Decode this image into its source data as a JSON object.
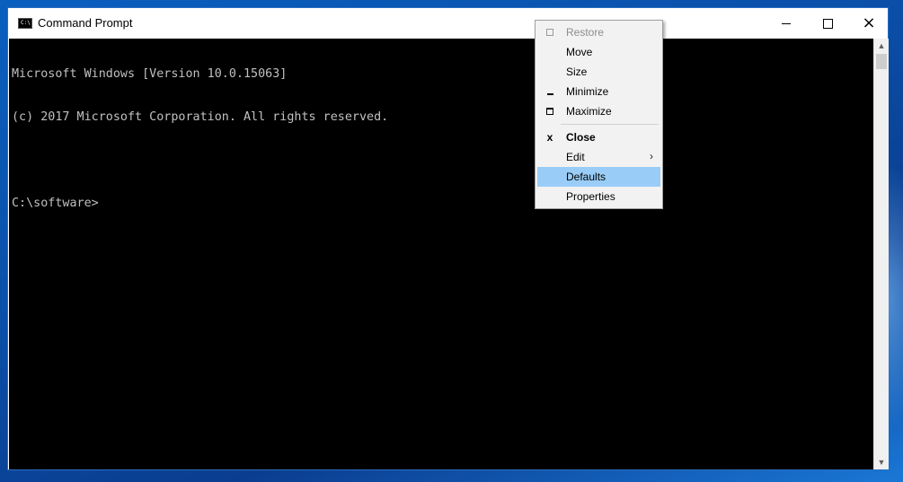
{
  "window": {
    "title": "Command Prompt",
    "app_icon_glyph": "C:\\",
    "controls": {
      "minimize": "minimize-icon",
      "maximize": "maximize-icon",
      "close": "×"
    }
  },
  "console": {
    "lines": [
      "Microsoft Windows [Version 10.0.15063]",
      "(c) 2017 Microsoft Corporation. All rights reserved.",
      "",
      "C:\\software>"
    ]
  },
  "system_menu": {
    "items": [
      {
        "label": "Restore",
        "icon": "restore-icon",
        "disabled": true
      },
      {
        "label": "Move"
      },
      {
        "label": "Size"
      },
      {
        "label": "Minimize",
        "icon": "minimize-icon"
      },
      {
        "label": "Maximize",
        "icon": "maximize-icon"
      },
      {
        "label": "Close",
        "icon": "close-icon",
        "icon_glyph": "x",
        "bold": true
      },
      {
        "label": "Edit",
        "submenu_arrow": "›"
      },
      {
        "label": "Defaults",
        "highlighted": true
      },
      {
        "label": "Properties"
      }
    ]
  },
  "colors": {
    "console_bg": "#000000",
    "console_text": "#c0c0c0",
    "menu_highlight": "#99cdf7",
    "desktop": "#0a5fbf"
  }
}
